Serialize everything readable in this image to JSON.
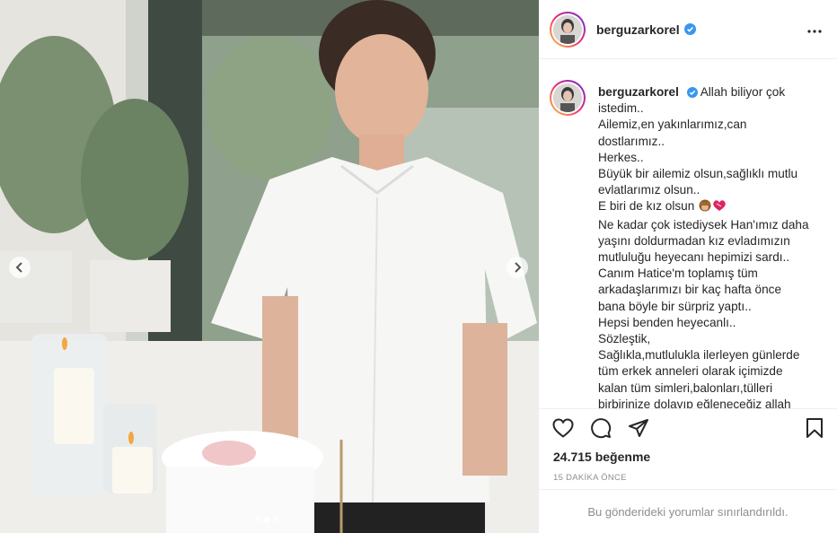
{
  "post": {
    "username": "berguzarkorel",
    "verified": true,
    "likes_text": "24.715 beğenme",
    "time_ago": "15 DAKİKA ÖNCE",
    "comments_notice": "Bu gönderideki yorumlar sınırlandırıldı.",
    "caption_first": "Allah biliyor çok",
    "caption_lines": [
      "istedim..",
      "Ailemiz,en yakınlarımız,can",
      "dostlarımız..",
      "Herkes..",
      "Büyük bir ailemiz olsun,sağlıklı mutlu",
      "evlatlarımız olsun..",
      "E biri de kız olsun",
      "Ne kadar çok istediysek Han'ımız daha",
      "yaşını doldurmadan kız evladımızın",
      "mutluluğu heyecanı hepimizi sardı..",
      "Canım Hatice'm toplamış tüm",
      "arkadaşlarımızı bir kaç hafta önce",
      "bana böyle bir sürpriz yaptı..",
      "Hepsi benden heyecanlı..",
      "Sözleştik,",
      "Sağlıkla,mutlulukla ilerleyen günlerde",
      "tüm erkek anneleri olarak içimizde",
      "kalan tüm simleri,balonları,tülleri",
      "birbirinize dolayıp eğleneceğiz allah"
    ],
    "carousel": {
      "count": 3,
      "active_index": 1
    }
  },
  "icons": {
    "like": "heart-icon",
    "comment": "comment-icon",
    "share": "paper-plane-icon",
    "save": "bookmark-icon",
    "more": "more-options-icon",
    "prev": "chevron-left-icon",
    "next": "chevron-right-icon",
    "verified": "verified-badge-icon"
  },
  "colors": {
    "verified_blue": "#3897f0",
    "text": "#262626",
    "muted": "#8e8e8e",
    "border": "#efefef"
  }
}
